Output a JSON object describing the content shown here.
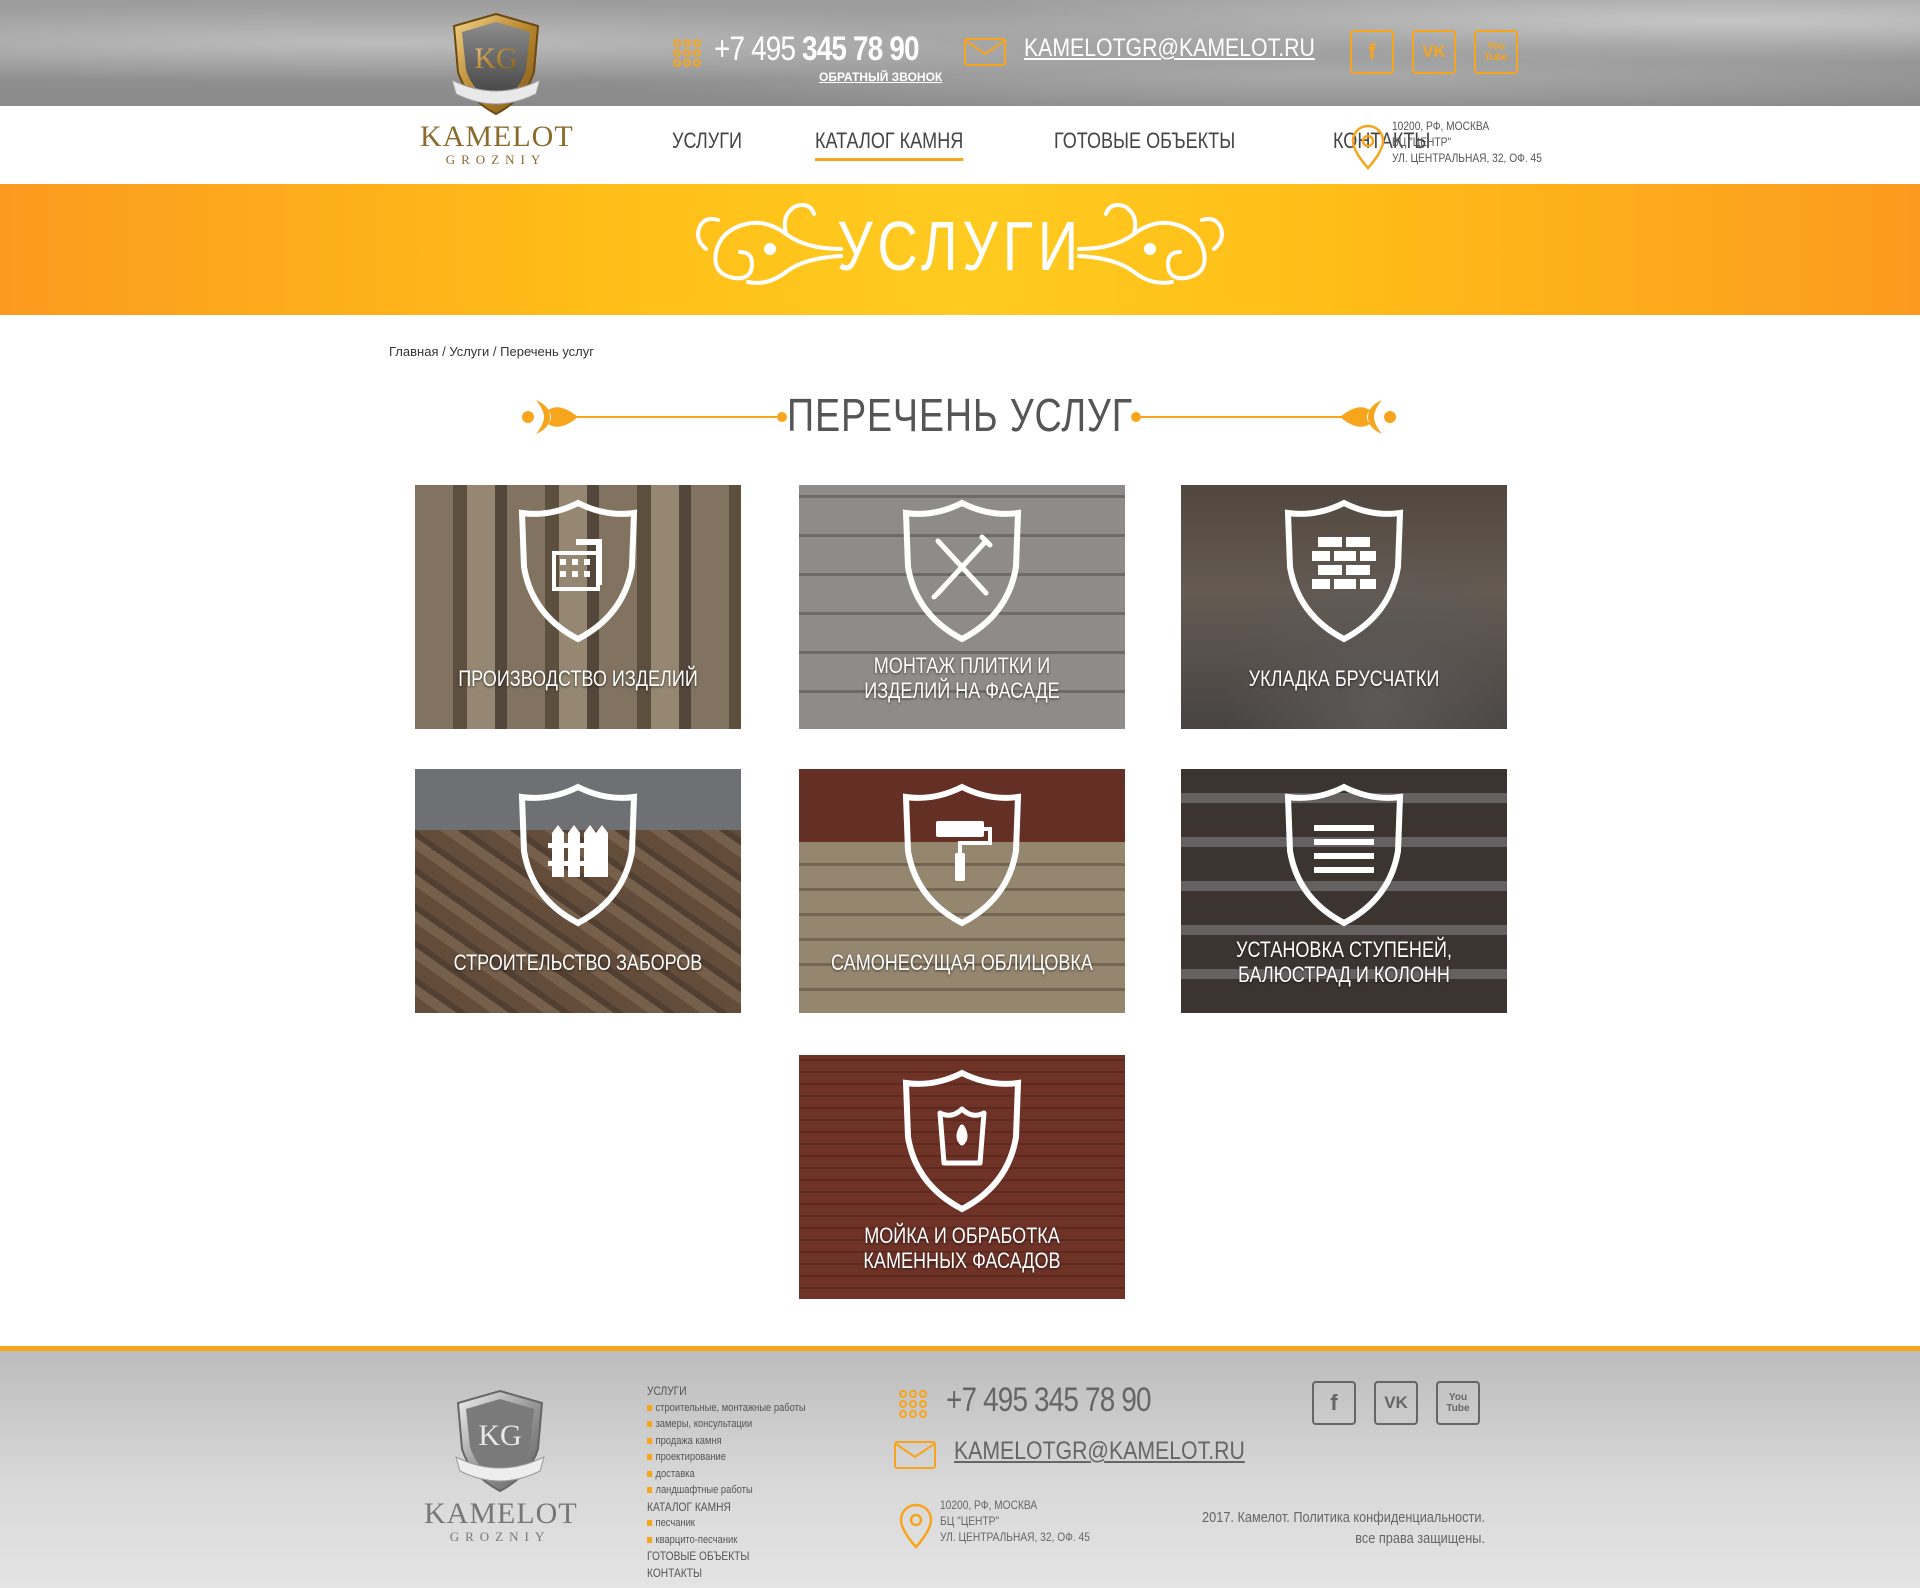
{
  "header": {
    "phone_prefix": "+7 495 ",
    "phone_main": "345 78 90",
    "callback_label": "ОБРАТНЫЙ ЗВОНОК",
    "email": "KAMELOTGR@KAMELOT.RU",
    "social": [
      "f",
      "VK",
      "You Tube"
    ]
  },
  "logo": {
    "monogram": "KG",
    "name": "KAMELOT",
    "sub": "GROZNIY"
  },
  "nav": {
    "items": [
      "УСЛУГИ",
      "КАТАЛОГ КАМНЯ",
      "ГОТОВЫЕ ОБЪЕКТЫ",
      "КОНТАКТЫ"
    ],
    "active_index": 1
  },
  "address": {
    "line1": "10200, РФ, МОСКВА",
    "line2": "БЦ \"ЦЕНТР\"",
    "line3": "УЛ. ЦЕНТРАЛЬНАЯ, 32, ОФ. 45"
  },
  "banner": {
    "title": "УСЛУГИ"
  },
  "breadcrumb": {
    "home": "Главная",
    "sep": " / ",
    "section": "Услуги",
    "current": "Перечень услуг"
  },
  "section_title": "ПЕРЕЧЕНЬ УСЛУГ",
  "services": [
    {
      "title_l1": "ПРОИЗВОДСТВО ИЗДЕЛИЙ",
      "title_l2": "",
      "icon": "building-icon"
    },
    {
      "title_l1": "МОНТАЖ ПЛИТКИ И",
      "title_l2": "ИЗДЕЛИЙ НА ФАСАДЕ",
      "icon": "tools-icon"
    },
    {
      "title_l1": "УКЛАДКА БРУСЧАТКИ",
      "title_l2": "",
      "icon": "bricks-icon"
    },
    {
      "title_l1": "СТРОИТЕЛЬСТВО ЗАБОРОВ",
      "title_l2": "",
      "icon": "fence-icon"
    },
    {
      "title_l1": "САМОНЕСУЩАЯ ОБЛИЦОВКА",
      "title_l2": "",
      "icon": "paint-roller-icon"
    },
    {
      "title_l1": "УСТАНОВКА СТУПЕНЕЙ,",
      "title_l2": "БАЛЮСТРАД И КОЛОНН",
      "icon": "stairs-icon"
    },
    {
      "title_l1": "МОЙКА И ОБРАБОТКА",
      "title_l2": "КАМЕННЫХ ФАСАДОВ",
      "icon": "bucket-icon"
    }
  ],
  "footer": {
    "menu": [
      {
        "type": "head",
        "label": "УСЛУГИ"
      },
      {
        "type": "sub",
        "label": "строительные, монтажные работы"
      },
      {
        "type": "sub",
        "label": "замеры, консультации"
      },
      {
        "type": "sub",
        "label": "продажа камня"
      },
      {
        "type": "sub",
        "label": "проектирование"
      },
      {
        "type": "sub",
        "label": "доставка"
      },
      {
        "type": "sub",
        "label": "ландшафтные работы"
      },
      {
        "type": "head",
        "label": "КАТАЛОГ КАМНЯ"
      },
      {
        "type": "sub",
        "label": "песчаник"
      },
      {
        "type": "sub",
        "label": "кварцито-песчаник"
      },
      {
        "type": "head",
        "label": "ГОТОВЫЕ ОБЪЕКТЫ"
      },
      {
        "type": "head",
        "label": "КОНТАКТЫ"
      }
    ],
    "phone": "+7 495 345 78 90",
    "email": "KAMELOTGR@KAMELOT.RU",
    "copy_l1": "2017. Камелот. Политика конфиденциальности.",
    "copy_l2": "все права защищены."
  },
  "colors": {
    "accent": "#f7a51c",
    "banner_center": "#ffcb20",
    "banner_edge": "#fb9a1f"
  }
}
